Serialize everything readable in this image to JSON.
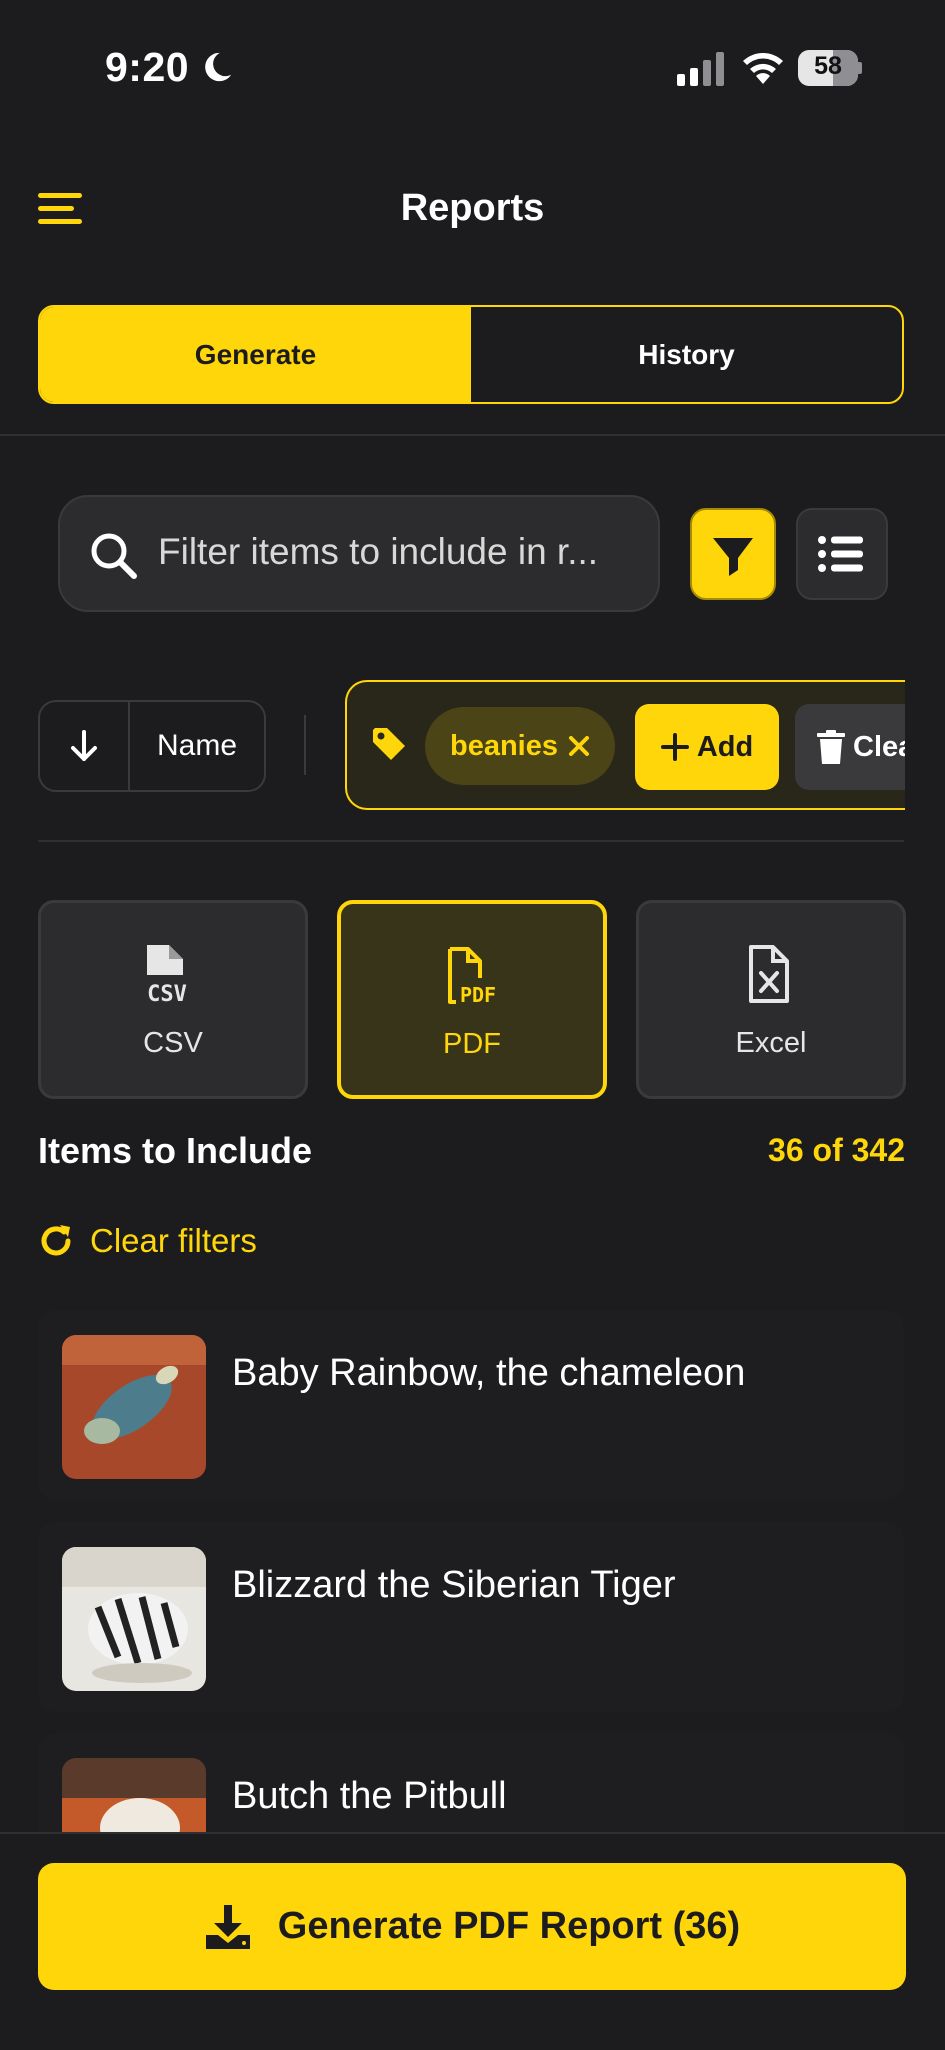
{
  "status_bar": {
    "time": "9:20",
    "battery": "58"
  },
  "header": {
    "title": "Reports"
  },
  "tabs": [
    {
      "label": "Generate",
      "active": true
    },
    {
      "label": "History",
      "active": false
    }
  ],
  "search": {
    "placeholder": "Filter items to include in r..."
  },
  "sort": {
    "label": "Name",
    "direction": "descending"
  },
  "tags": {
    "chips": [
      "beanies"
    ],
    "add_label": "Add",
    "clear_label": "Clear"
  },
  "formats": [
    {
      "label": "CSV",
      "icon": "csv-file-icon",
      "selected": false
    },
    {
      "label": "PDF",
      "icon": "pdf-file-icon",
      "selected": true
    },
    {
      "label": "Excel",
      "icon": "excel-file-icon",
      "selected": false
    }
  ],
  "items_section": {
    "title": "Items to Include",
    "count": "36 of 342",
    "clear_filters": "Clear filters"
  },
  "items": [
    {
      "name": "Baby Rainbow, the chameleon"
    },
    {
      "name": "Blizzard the Siberian Tiger"
    },
    {
      "name": "Butch the Pitbull"
    }
  ],
  "generate_button": {
    "label": "Generate PDF Report (36)"
  },
  "colors": {
    "accent": "#ffd60a",
    "background": "#1c1c1e",
    "surface": "#2c2c2e"
  }
}
